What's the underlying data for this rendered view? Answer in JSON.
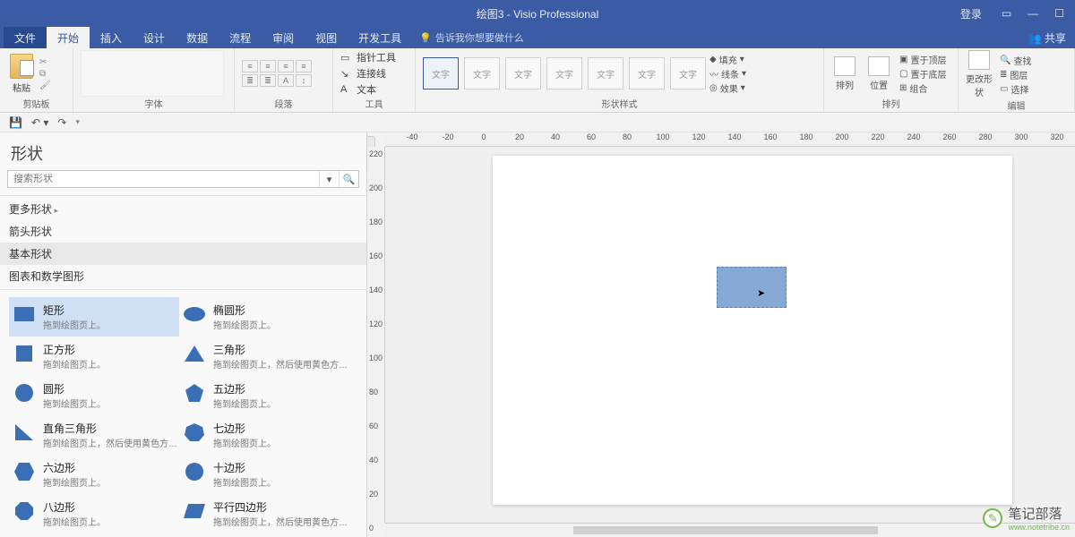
{
  "titlebar": {
    "title": "绘图3 - Visio Professional",
    "login": "登录"
  },
  "tabs": {
    "file": "文件",
    "home": "开始",
    "insert": "插入",
    "design": "设计",
    "data": "数据",
    "process": "流程",
    "review": "审阅",
    "view": "视图",
    "dev": "开发工具",
    "tell_me": "告诉我你想要做什么",
    "share": "共享"
  },
  "ribbon": {
    "clipboard": {
      "paste": "粘贴",
      "label": "剪贴板"
    },
    "font": {
      "label": "字体"
    },
    "paragraph": {
      "label": "段落"
    },
    "tools": {
      "pointer": "指针工具",
      "connector": "连接线",
      "text": "文本",
      "label": "工具"
    },
    "styles": {
      "swatch": "文字",
      "fill": "填充",
      "line": "线条",
      "effects": "效果",
      "label": "形状样式"
    },
    "arrange": {
      "tofront": "置于顶层",
      "toback": "置于底层",
      "group": "组合",
      "sort": "排列",
      "position": "位置",
      "label": "排列"
    },
    "edit": {
      "change": "更改形状",
      "find": "查找",
      "layer": "图层",
      "select": "选择",
      "label": "编辑"
    }
  },
  "shapes": {
    "title": "形状",
    "search_placeholder": "搜索形状",
    "stencils": {
      "more": "更多形状",
      "arrow": "箭头形状",
      "basic": "基本形状",
      "chart": "图表和数学图形"
    },
    "drag_hint": "拖到绘图页上。",
    "drag_hint_tri": "拖到绘图页上，然后使用黄色方形...",
    "items": [
      {
        "l": "矩形",
        "r": "椭圆形"
      },
      {
        "l": "正方形",
        "r": "三角形"
      },
      {
        "l": "圆形",
        "r": "五边形"
      },
      {
        "l": "直角三角形",
        "r": "七边形"
      },
      {
        "l": "六边形",
        "r": "十边形"
      },
      {
        "l": "八边形",
        "r": "平行四边形"
      }
    ]
  },
  "ruler_h": [
    "-40",
    "-20",
    "0",
    "20",
    "40",
    "60",
    "80",
    "100",
    "120",
    "140",
    "160",
    "180",
    "200",
    "220",
    "240",
    "260",
    "280",
    "300",
    "320"
  ],
  "ruler_v": [
    "220",
    "200",
    "180",
    "160",
    "140",
    "120",
    "100",
    "80",
    "60",
    "40",
    "20",
    "0"
  ],
  "watermark": {
    "cn": "笔记部落",
    "url": "www.notetribe.cn"
  }
}
